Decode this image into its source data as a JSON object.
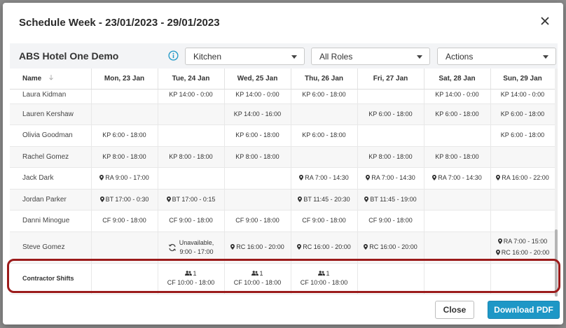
{
  "modal": {
    "title": "Schedule Week - 23/01/2023 - 29/01/2023"
  },
  "toolbar": {
    "company": "ABS Hotel One Demo",
    "department": "Kitchen",
    "roles": "All Roles",
    "actions": "Actions"
  },
  "table": {
    "name_header": "Name",
    "days": [
      "Mon, 23 Jan",
      "Tue, 24 Jan",
      "Wed, 25 Jan",
      "Thu, 26 Jan",
      "Fri, 27 Jan",
      "Sat, 28 Jan",
      "Sun, 29 Jan"
    ],
    "rows": [
      {
        "name": "Laura Kidman",
        "cells": [
          "",
          "KP 14:00 - 0:00",
          "KP 14:00 - 0:00",
          "KP 6:00 - 18:00",
          "",
          "KP 14:00 - 0:00",
          "KP 14:00 - 0:00"
        ]
      },
      {
        "name": "Lauren Kershaw",
        "cells": [
          "",
          "",
          "KP 14:00 - 16:00",
          "",
          "KP 6:00 - 18:00",
          "KP 6:00 - 18:00",
          "KP 6:00 - 18:00"
        ]
      },
      {
        "name": "Olivia Goodman",
        "cells": [
          "KP 6:00 - 18:00",
          "",
          "KP 6:00 - 18:00",
          "KP 6:00 - 18:00",
          "",
          "",
          "KP 6:00 - 18:00"
        ]
      },
      {
        "name": "Rachel Gomez",
        "cells": [
          "KP 8:00 - 18:00",
          "KP 8:00 - 18:00",
          "KP 8:00 - 18:00",
          "",
          "KP 8:00 - 18:00",
          "KP 8:00 - 18:00",
          ""
        ]
      },
      {
        "name": "Jack Dark",
        "cells": [
          "RA 9:00 - 17:00",
          "",
          "",
          "RA 7:00 - 14:30",
          "RA 7:00 - 14:30",
          "RA 7:00 - 14:30",
          "RA 16:00 - 22:00"
        ]
      },
      {
        "name": "Jordan Parker",
        "cells": [
          "BT 17:00 - 0:30",
          "BT 17:00 - 0:15",
          "",
          "BT 11:45 - 20:30",
          "BT 11:45 - 19:00",
          "",
          ""
        ]
      },
      {
        "name": "Danni Minogue",
        "cells": [
          "CF 9:00 - 18:00",
          "CF 9:00 - 18:00",
          "CF 9:00 - 18:00",
          "CF 9:00 - 18:00",
          "CF 9:00 - 18:00",
          "",
          ""
        ]
      },
      {
        "name": "Steve Gomez",
        "cells": [
          "",
          "",
          "RC 16:00 - 20:00",
          "RC 16:00 - 20:00",
          "RC 16:00 - 20:00",
          "",
          ""
        ],
        "unavailable": [
          "Unavailable,",
          "9:00 - 17:00"
        ],
        "sun": [
          "RA 7:00 - 15:00",
          "RC 16:00 - 20:00"
        ]
      }
    ],
    "contractor": {
      "name": "Contractor Shifts",
      "count": "1",
      "shift": "CF 10:00 - 18:00"
    }
  },
  "buttons": {
    "close": "Close",
    "download": "Download PDF"
  },
  "colors": {
    "accent": "#1e97c6",
    "highlight": "#9b1b1b",
    "info": "#1e97c6"
  }
}
